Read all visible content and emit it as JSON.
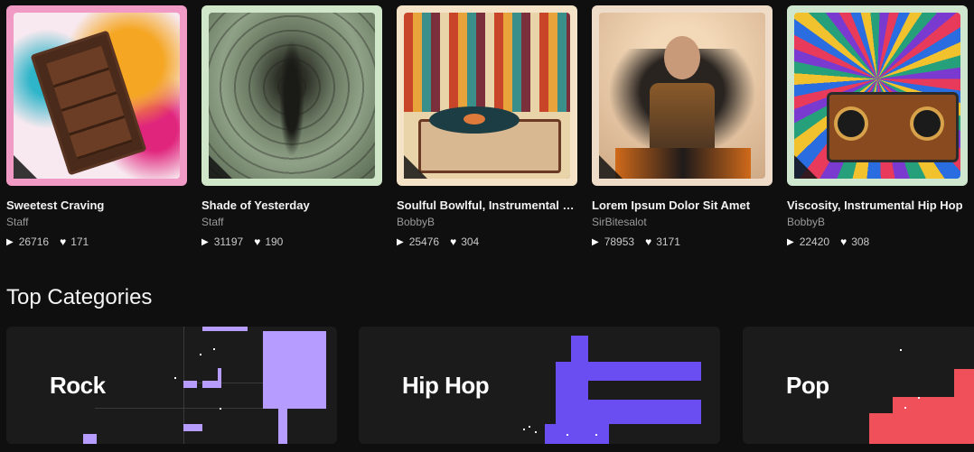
{
  "tracks": [
    {
      "title": "Sweetest Craving",
      "artist": "Staff",
      "plays": "26716",
      "likes": "171",
      "frame_color": "#f29ac6"
    },
    {
      "title": "Shade of Yesterday",
      "artist": "Staff",
      "plays": "31197",
      "likes": "190",
      "frame_color": "#cfe6c9"
    },
    {
      "title": "Soulful Bowlful, Instrumental Hi...",
      "artist": "BobbyB",
      "plays": "25476",
      "likes": "304",
      "frame_color": "#f4e3c6"
    },
    {
      "title": "Lorem Ipsum Dolor Sit Amet",
      "artist": "SirBitesalot",
      "plays": "78953",
      "likes": "3171",
      "frame_color": "#eedcc8"
    },
    {
      "title": "Viscosity, Instrumental Hip Hop",
      "artist": "BobbyB",
      "plays": "22420",
      "likes": "308",
      "frame_color": "#cfe6cf"
    }
  ],
  "section": {
    "title": "Top Categories"
  },
  "categories": [
    {
      "label": "Rock",
      "accent": "#b79cff"
    },
    {
      "label": "Hip Hop",
      "accent": "#6b4ef2"
    },
    {
      "label": "Pop",
      "accent": "#f0505a"
    }
  ],
  "icons": {
    "play": "play-icon",
    "like": "heart-icon"
  }
}
